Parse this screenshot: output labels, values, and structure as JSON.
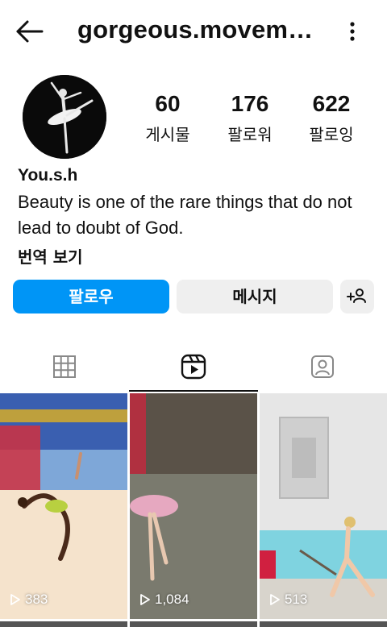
{
  "header": {
    "username": "gorgeous.movem…",
    "back_icon": "arrow-left-icon",
    "more_icon": "vertical-dots-icon"
  },
  "stats": [
    {
      "value": "60",
      "label": "게시물"
    },
    {
      "value": "176",
      "label": "팔로워"
    },
    {
      "value": "622",
      "label": "팔로잉"
    }
  ],
  "profile": {
    "name": "You.s.h",
    "bio": "Beauty is one of the rare things that do not lead to doubt of God.",
    "translate_label": "번역 보기"
  },
  "actions": {
    "follow_label": "팔로우",
    "message_label": "메시지",
    "suggest_icon": "add-person-icon"
  },
  "colors": {
    "accent": "#0095f6",
    "secondary_button": "#efefef"
  },
  "tabs": [
    {
      "icon": "grid-icon",
      "active": false
    },
    {
      "icon": "reels-icon",
      "active": true
    },
    {
      "icon": "tagged-person-icon",
      "active": false
    }
  ],
  "reels": [
    {
      "views": "383"
    },
    {
      "views": "1,084"
    },
    {
      "views": "513"
    }
  ]
}
